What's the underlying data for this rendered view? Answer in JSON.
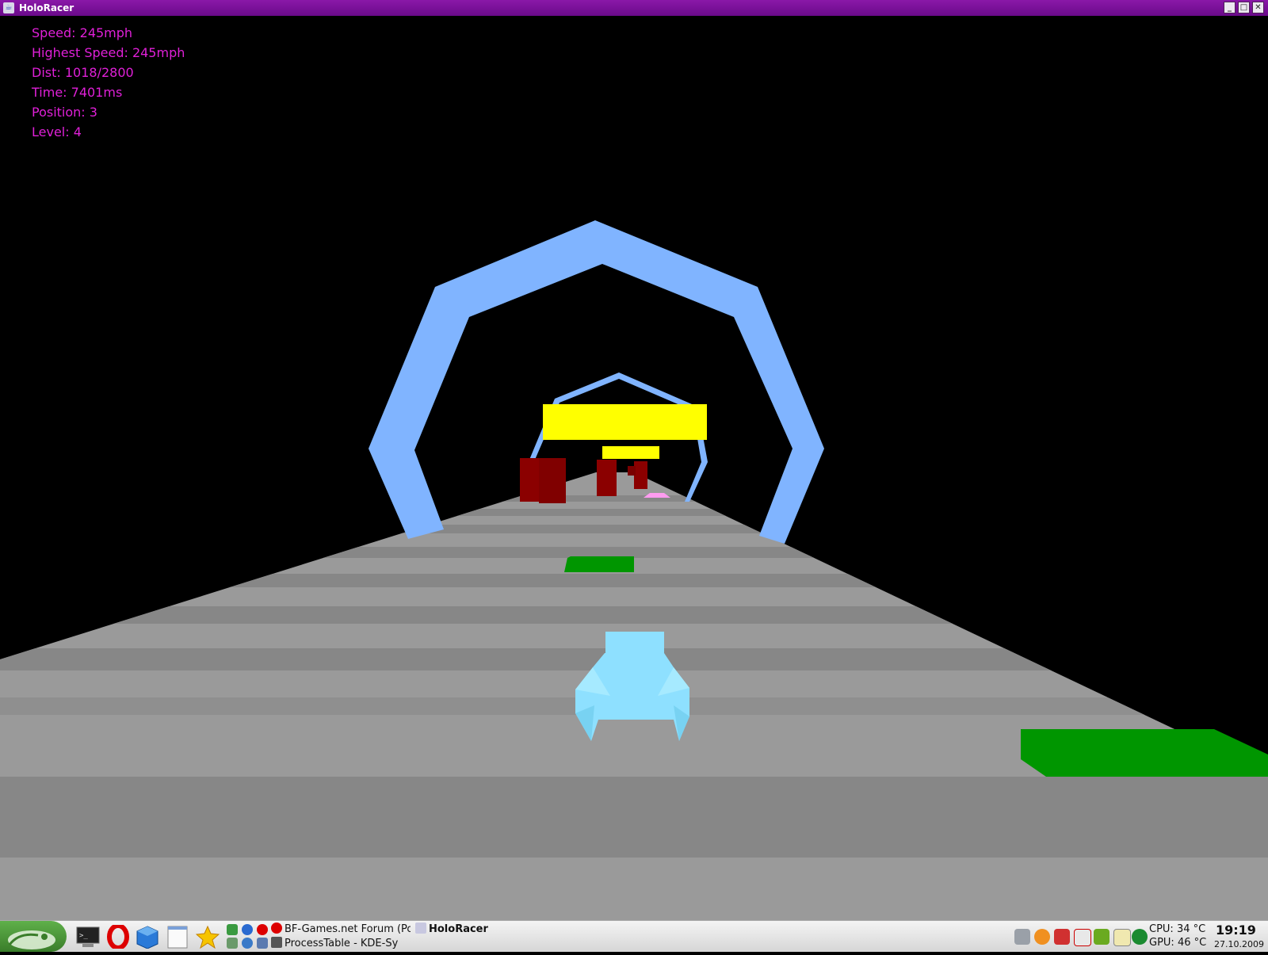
{
  "window": {
    "title": "HoloRacer",
    "icon": "java-cup-icon",
    "controls": {
      "minimize": "_",
      "maximize": "□",
      "close": "✕"
    }
  },
  "hud": {
    "speed": "Speed: 245mph",
    "highest_speed": "Highest Speed: 245mph",
    "dist": "Dist: 1018/2800",
    "time": "Time: 7401ms",
    "position": "Position: 3",
    "level": "Level: 4"
  },
  "scene": {
    "colors": {
      "background": "#000000",
      "track_light": "#9a9a9a",
      "track_dark": "#858585",
      "ring": "#80b4ff",
      "banner": "#ffff00",
      "obstacle": "#8b0000",
      "boost_pad": "#009600",
      "player_ship": "#8ee0ff",
      "rival_ship": "#ff9cf0",
      "hud_text": "#e020d8"
    }
  },
  "taskbar": {
    "start_icon": "opensuse-gecko-icon",
    "quick_launch": [
      "terminal-icon",
      "opera-icon",
      "package-box-icon",
      "notes-icon",
      "bookmark-star-icon"
    ],
    "tasks": [
      {
        "label": "BF-Games.net Forum (Po",
        "icon": "opera-icon",
        "active": false
      },
      {
        "label": "HoloRacer",
        "icon": "java-cup-icon",
        "active": true
      },
      {
        "label": "ProcessTable - KDE-Sy",
        "icon": "floppy-icon",
        "active": false
      }
    ],
    "tray": [
      "volume-icon",
      "sun-update-icon",
      "java-tray-icon",
      "mail-tray-icon",
      "nvidia-icon",
      "klipper-icon",
      "network-globe-icon"
    ],
    "cpu": "CPU: 34 °C",
    "gpu": "GPU: 46 °C",
    "clock": "19:19",
    "date": "27.10.2009"
  }
}
